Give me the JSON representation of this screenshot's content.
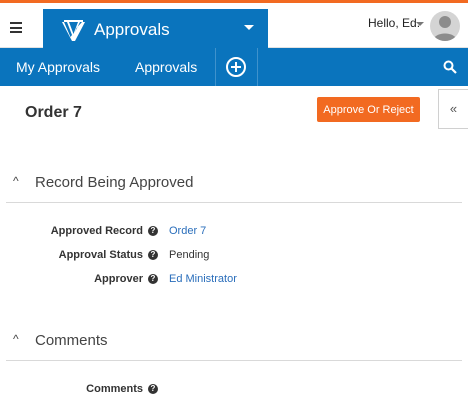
{
  "header": {
    "app_title": "Approvals",
    "user_greeting": "Hello, Ed."
  },
  "nav": {
    "items": [
      {
        "label": "My Approvals"
      },
      {
        "label": "Approvals"
      }
    ]
  },
  "page": {
    "title": "Order 7",
    "approve_button_label": "Approve Or Reject",
    "collapse_label": "«"
  },
  "sections": {
    "record": {
      "title": "Record Being Approved",
      "fields": [
        {
          "label": "Approved Record",
          "value": "Order 7"
        },
        {
          "label": "Approval Status",
          "value": "Pending"
        },
        {
          "label": "Approver",
          "value": "Ed Ministrator"
        }
      ]
    },
    "comments": {
      "title": "Comments",
      "fields": [
        {
          "label": "Comments",
          "value": ""
        }
      ]
    }
  },
  "colors": {
    "brand_blue": "#0a74bd",
    "accent_orange": "#f26a21",
    "link_blue": "#2a6ebb"
  },
  "icons": [
    "menu-icon",
    "app-logo-icon",
    "chevron-down-icon",
    "avatar-icon",
    "add-icon",
    "search-icon",
    "collapse-icon",
    "chevron-up-icon",
    "help-icon"
  ]
}
